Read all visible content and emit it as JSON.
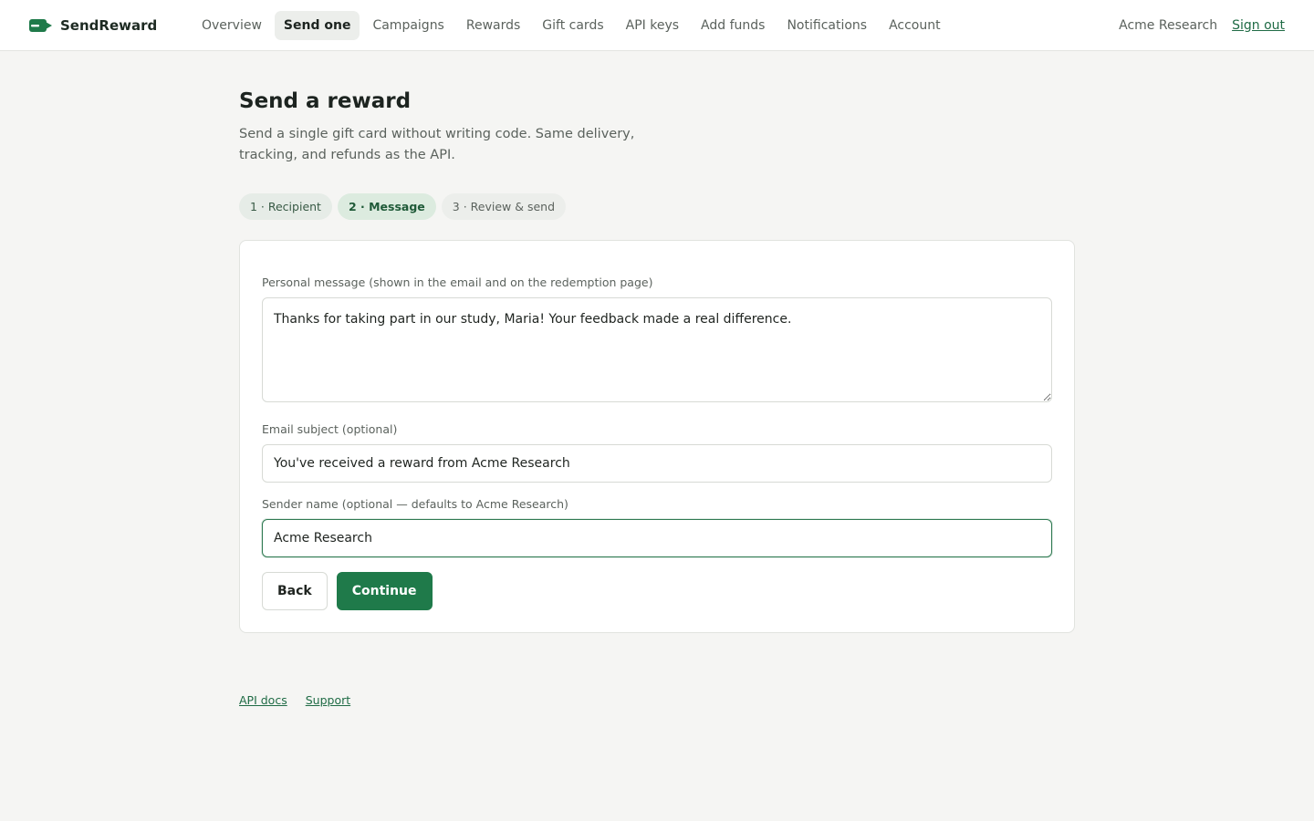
{
  "header": {
    "brand": "SendReward",
    "nav": [
      {
        "label": "Overview"
      },
      {
        "label": "Send one",
        "active": true
      },
      {
        "label": "Campaigns"
      },
      {
        "label": "Rewards"
      },
      {
        "label": "Gift cards"
      },
      {
        "label": "API keys"
      },
      {
        "label": "Add funds"
      },
      {
        "label": "Notifications"
      },
      {
        "label": "Account"
      }
    ],
    "org": "Acme Research",
    "signout": "Sign out"
  },
  "page": {
    "title": "Send a reward",
    "subtitle": "Send a single gift card without writing code. Same delivery, tracking, and refunds as the API."
  },
  "steps": [
    {
      "label": "1 · Recipient",
      "state": "done"
    },
    {
      "label": "2 · Message",
      "state": "current"
    },
    {
      "label": "3 · Review & send",
      "state": "upcoming"
    }
  ],
  "form": {
    "message_label": "Personal message (shown in the email and on the redemption page)",
    "message_value": "Thanks for taking part in our study, Maria! Your feedback made a real difference.",
    "subject_label": "Email subject (optional)",
    "subject_value": "You've received a reward from Acme Research",
    "sender_label": "Sender name (optional — defaults to Acme Research)",
    "sender_value": "Acme Research",
    "back_label": "Back",
    "continue_label": "Continue"
  },
  "footer": {
    "api_docs": "API docs",
    "support": "Support"
  },
  "colors": {
    "accent": "#1f7a4a",
    "background": "#f5f5f3"
  },
  "icons": {
    "brand": "gift-card-arrow-icon"
  }
}
